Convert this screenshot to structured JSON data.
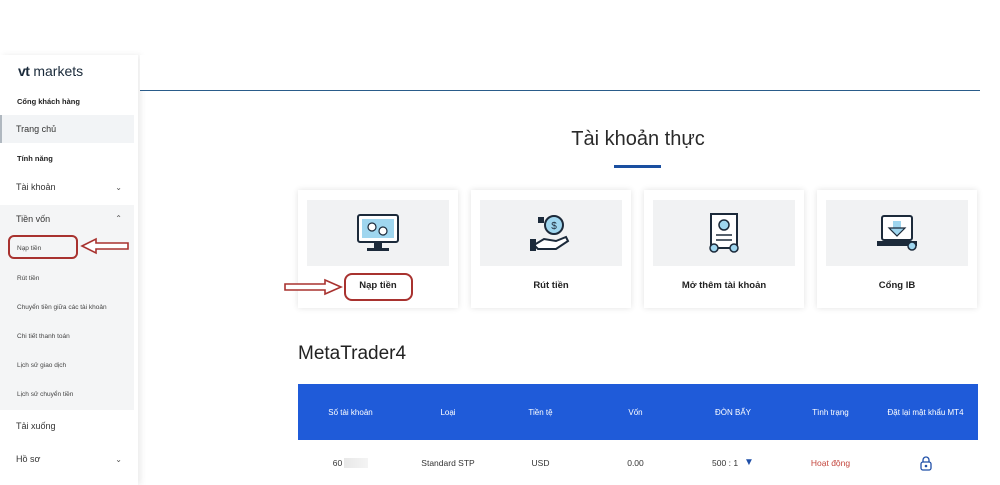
{
  "sidebar": {
    "logo_bold": "vt",
    "logo_rest": " markets",
    "portal_title": "Cổng khách hàng",
    "home": "Trang chủ",
    "features_title": "Tính năng",
    "account": "Tài khoản",
    "funds": "Tiền vốn",
    "deposit": "Nạp tiền",
    "withdraw": "Rút tiền",
    "transfer": "Chuyển tiền giữa các tài khoản",
    "payment_details": "Chi tiết thanh toán",
    "trade_history": "Lịch sử giao dịch",
    "transfer_history": "Lịch sử chuyển tiền",
    "downloads": "Tải xuống",
    "profile": "Hồ sơ",
    "chevron_down": "⌄",
    "chevron_up": "⌃"
  },
  "main": {
    "title": "Tài khoản thực",
    "cards": [
      {
        "label": "Nạp tiền",
        "icon": "monitor-deposit-icon"
      },
      {
        "label": "Rút tiền",
        "icon": "hand-coin-withdraw-icon"
      },
      {
        "label": "Mở thêm tài khoản",
        "icon": "document-open-account-icon"
      },
      {
        "label": "Cổng IB",
        "icon": "laptop-download-ib-icon"
      }
    ],
    "platform": "MetaTrader4"
  },
  "table": {
    "headers": [
      "Số tài khoản",
      "Loại",
      "Tiền tệ",
      "Vốn",
      "ĐÒN BẨY",
      "Tình trạng",
      "Đặt lại mật khẩu MT4"
    ],
    "row": {
      "account": "60",
      "type": "Standard STP",
      "currency": "USD",
      "balance": "0.00",
      "leverage": "500 : 1",
      "leverage_caret": "▼",
      "status": "Hoạt động"
    }
  },
  "colors": {
    "header_blue": "#1f5bd9",
    "accent_red": "#a8322f",
    "status_red": "#c4473e",
    "title_underline": "#1a4fa0"
  }
}
